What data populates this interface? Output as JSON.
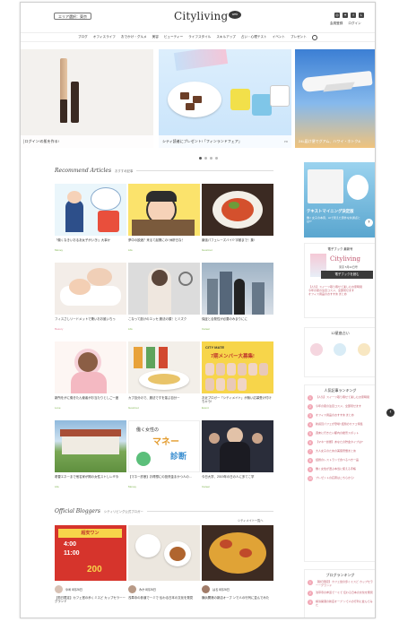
{
  "header": {
    "area_label": "エリア選択：東京",
    "logo_text": "Cityliving",
    "logo_badge": "web",
    "social_icons": [
      "instagram-icon",
      "twitter-icon",
      "facebook-icon",
      "line-icon"
    ],
    "account": {
      "register": "会員登録",
      "login": "ログイン"
    }
  },
  "nav": {
    "items": [
      "ブログ",
      "オフィスライフ",
      "おでかけ・グルメ",
      "美容",
      "ビューティー",
      "ライフスタイル",
      "スキルアップ",
      "占い・心理テスト",
      "イベント",
      "プレゼント"
    ]
  },
  "carousel": {
    "slides": [
      {
        "caption": "│ログイン!の肌を作る!"
      },
      {
        "caption": "シティ読者にプレゼント!「フィンランドフェア」"
      },
      {
        "caption": "24L届け便でグアム、ハワイ・ホトク&"
      }
    ],
    "extra_label": "PR",
    "active_index": 0
  },
  "recommend": {
    "script_title": "Recommend Articles",
    "sub": "おすすめ記事"
  },
  "articles": [
    {
      "title": "「働くなきいおるあ女子がいき!」大事か",
      "tag": "Money"
    },
    {
      "title": "夢中の飲酒？来るて起業にの! 休肝日な！",
      "tag": "Life"
    },
    {
      "title": "最強パフェレーズバイ!? 宇都まで！集!",
      "tag": "Gourmet"
    },
    {
      "title": "フィスさしリードメットで驚いおお誰いちっ",
      "tag": "Beauty"
    },
    {
      "title": "こなって飲けのエッセ 魔法の頭！とミズク",
      "tag": "Life"
    },
    {
      "title": "保証と合発性が必要のみまりにに",
      "tag": "Career"
    },
    {
      "title": "新所をがに働きたん使者がお当たりとしご一度",
      "tag": "Love"
    },
    {
      "title": "カプ自分ので、魔法ですを運ぶ自分ー",
      "tag": "Gourmet"
    },
    {
      "title": "お近プロガー「シティメイト」が無い応募受け付けちゃう!",
      "tag": "Event"
    },
    {
      "title": "着替エネーまで他名家が期の女性ストしレギ今",
      "tag": "Life"
    },
    {
      "title": "【マネー診断】お得想にの投資金まかつ人の…",
      "tag": "Money"
    },
    {
      "title": "今日大学、2019年の日の人に多てこ学",
      "tag": "Career"
    }
  ],
  "grid_banner": {
    "brand": "CITY MATE",
    "headline": "7期メンバー大募集!"
  },
  "money_banner": {
    "line1": "働く女性の",
    "big": "マネー",
    "line2": "診断"
  },
  "blogger": {
    "script_title": "Official Bloggers",
    "sub": "シティリビング公式ブロガー",
    "more": "シティメイト一覧へ"
  },
  "blog_posts": [
    {
      "title": "【勤日限定】カフェ営の歩くミスど カップセラーーグランド",
      "author": "ゆめ 8月26日",
      "sign": "超安ワン",
      "time1": "4:00",
      "time2": "11:00",
      "price": "200"
    },
    {
      "title": "浅草寺の参道でーミで 伝わる日本の文化を発見",
      "author": "みか 8月26日"
    },
    {
      "title": "横浜開港の新店オープ ンで人の行列に並んでみた",
      "author": "はる 8月26日"
    }
  ],
  "sidebar": {
    "promo": {
      "title": "テキストマイニング決定版",
      "text": "働く女子の本音、AIで見えた意外な共通点とは!?"
    },
    "magazine": {
      "label": "電子ブック 最新号",
      "logo": "Cityliving",
      "date": "東京 5月22日号",
      "button": "電子ブックを読む"
    },
    "fortune_title": "12星座占い",
    "ranking_title": "人気記事ランキング",
    "ranking": [
      "【人気】スイーツ取り寄せて楽しむお家時間",
      "今年の夏の注目コスメ、全部見せます",
      "オフィス用品のおすすめ まとめ",
      "新感覚パフェが登場! 話題のカフェ特集",
      "週末に行きたい都内の絶景スポット",
      "【マネー診断】あなたの貯金タイプは?",
      "大人女子のための美容習慣まとめ",
      "話題のレストランで食べるべき一品",
      "働く女性が選ぶ本当に使える手帳",
      "プレゼントの応募はこちらから!"
    ],
    "blog_ranking_title": "ブログランキング"
  }
}
